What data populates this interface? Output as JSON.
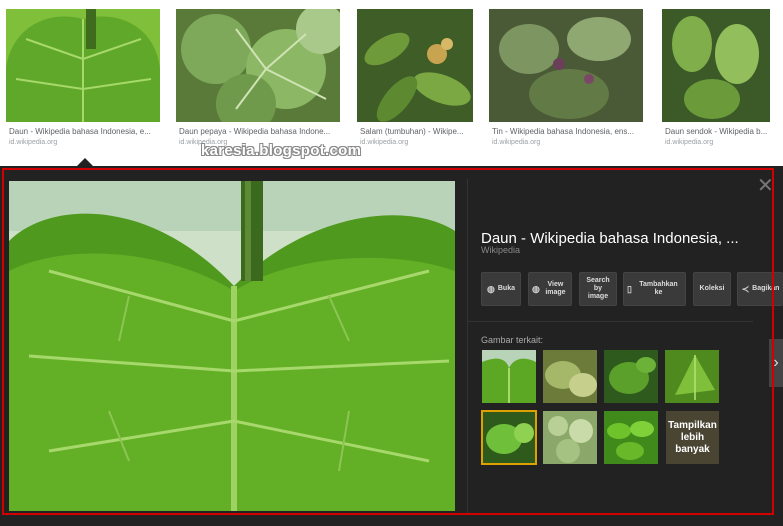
{
  "thumbnails": [
    {
      "title": "Daun - Wikipedia bahasa Indonesia, e...",
      "source": "id.wikipedia.org"
    },
    {
      "title": "Daun pepaya - Wikipedia bahasa Indone...",
      "source": "id.wikipedia.org"
    },
    {
      "title": "Salam (tumbuhan) - Wikipe...",
      "source": "id.wikipedia.org"
    },
    {
      "title": "Tin - Wikipedia bahasa Indonesia, ens...",
      "source": "id.wikipedia.org"
    },
    {
      "title": "Daun sendok - Wikipedia b...",
      "source": "id.wikipedia.org"
    }
  ],
  "watermark": "karesia.blogspot.com",
  "preview": {
    "title": "Daun - Wikipedia bahasa Indonesia, ...",
    "source": "Wikipedia",
    "close": "✕",
    "buttons": {
      "open": "Buka",
      "view_image": "View image",
      "search_by_image": "Search by image",
      "add_to": "Tambahkan ke",
      "collection": "Koleksi",
      "share": "Bagikan"
    },
    "related_label": "Gambar terkait:",
    "more_label": "Tampilkan lebih banyak"
  },
  "colors": {
    "accent_frame": "#d40000",
    "panel_bg": "#222222",
    "selected": "#e0a000"
  }
}
